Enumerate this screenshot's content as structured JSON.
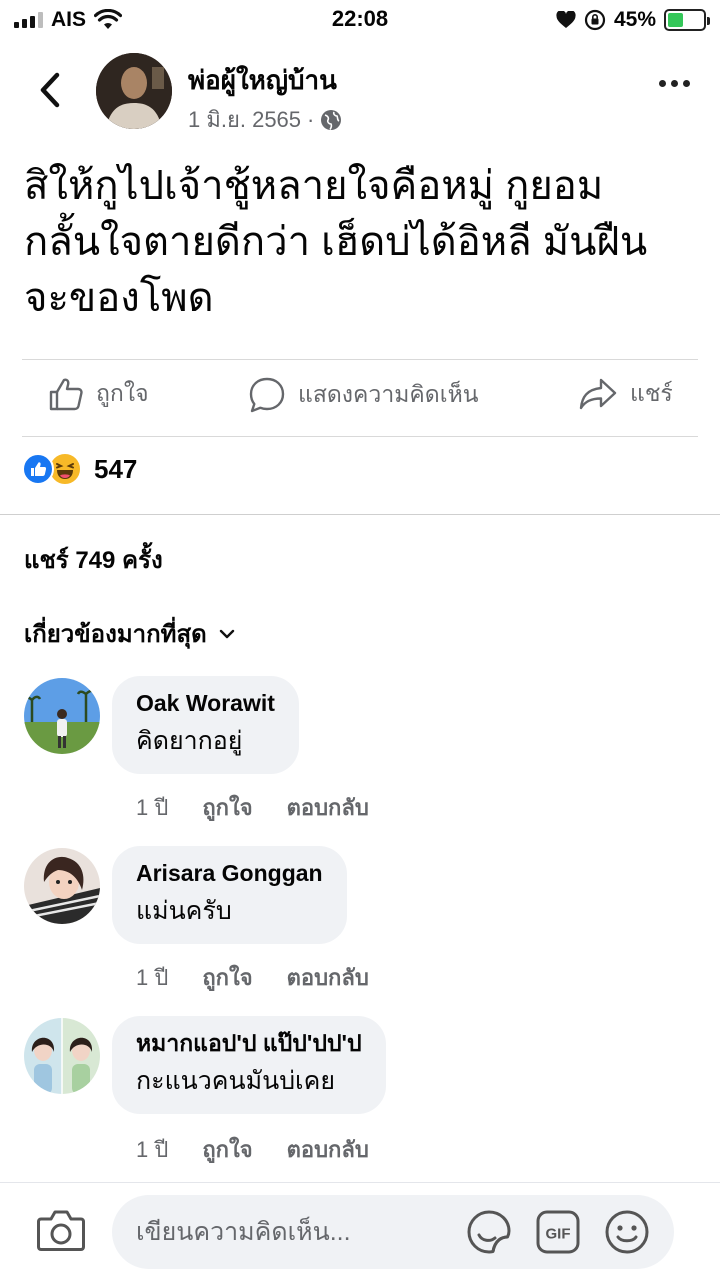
{
  "status_bar": {
    "carrier": "AIS",
    "time": "22:08",
    "battery_percent": "45%"
  },
  "post": {
    "author": "พ่อผู้ใหญ่บ้าน",
    "date": "1 มิ.ย. 2565",
    "date_separator": "·",
    "lines": [
      "สิให้กูไปเจ้าชู้หลายใจคือหมู่ กูยอม",
      "กลั้นใจตายดีกว่า เฮ็ดบ่ได้อิหลี มันฝืน",
      "จะของโพด"
    ]
  },
  "actions": {
    "like": "ถูกใจ",
    "comment": "แสดงความคิดเห็น",
    "share": "แชร์"
  },
  "reactions": {
    "count": "547"
  },
  "shares": {
    "label": "แชร์ 749 ครั้ง"
  },
  "sort": {
    "label": "เกี่ยวข้องมากที่สุด"
  },
  "comments": [
    {
      "author": "Oak Worawit",
      "text": "คิดยากอยู่",
      "time": "1 ปี",
      "like": "ถูกใจ",
      "reply": "ตอบกลับ"
    },
    {
      "author": "Arisara Gonggan",
      "text": "แม่นครับ",
      "time": "1 ปี",
      "like": "ถูกใจ",
      "reply": "ตอบกลับ"
    },
    {
      "author": "หมากแอป'ป แป๊ป'ปป'ป",
      "text": "กะแนวคนมันบ่เคย",
      "time": "1 ปี",
      "like": "ถูกใจ",
      "reply": "ตอบกลับ"
    }
  ],
  "composer": {
    "placeholder": "เขียนความคิดเห็น...",
    "gif_label": "GIF"
  },
  "colors": {
    "accent": "#1877f2",
    "secondary_text": "#65676b",
    "bubble": "#f0f2f5",
    "haha": "#f7b928",
    "battery": "#34c759"
  }
}
